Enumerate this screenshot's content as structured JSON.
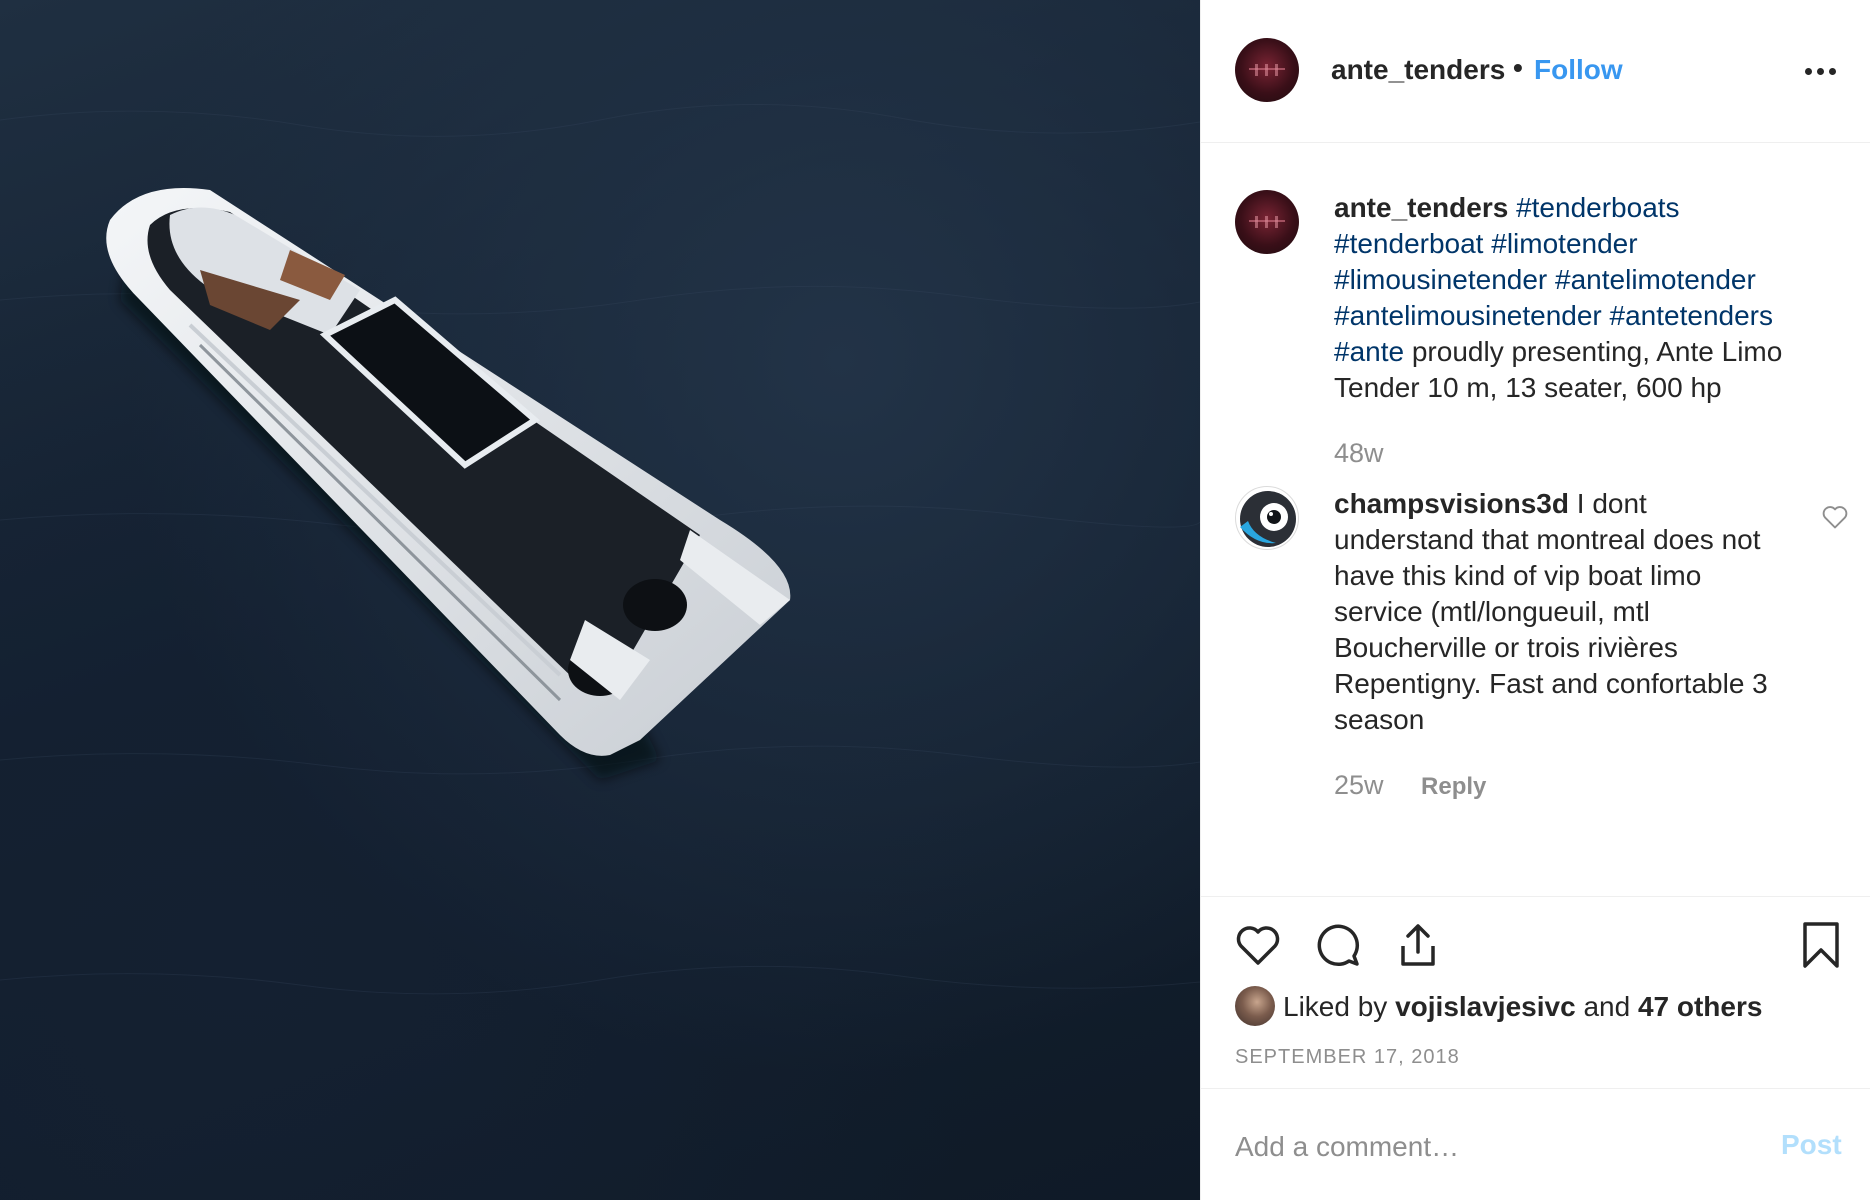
{
  "post": {
    "username": "ante_tenders",
    "separator": "•",
    "follow_label": "Follow",
    "more_icon": "more-horizontal-icon"
  },
  "caption": {
    "username": "ante_tenders",
    "hashtags": [
      "#tenderboats",
      "#tenderboat",
      "#limotender",
      "#limousinetender",
      "#antelimotender",
      "#antelimousinetender",
      "#antetenders",
      "#ante"
    ],
    "text": "proudly presenting, Ante Limo Tender 10 m, 13 seater, 600 hp",
    "time": "48w"
  },
  "comment": {
    "username": "champsvisions3d",
    "text": "I dont understand that montreal does not have this kind of vip boat limo service (mtl/longueuil, mtl Boucherville or trois rivières Repentigny. Fast and confortable 3 season",
    "time": "25w",
    "reply_label": "Reply"
  },
  "actions": {
    "icons": [
      "heart-icon",
      "comment-icon",
      "share-icon",
      "bookmark-icon"
    ]
  },
  "likes": {
    "prefix": "Liked by",
    "user": "vojislavjesivc",
    "conjunction": "and",
    "others": "47 others"
  },
  "date": "SEPTEMBER 17, 2018",
  "add_comment": {
    "placeholder": "Add a comment…",
    "post_label": "Post"
  },
  "colors": {
    "link": "#3897f0",
    "hashtag": "#003569",
    "muted": "#8e8e8e",
    "post_disabled": "#b2dffc"
  }
}
